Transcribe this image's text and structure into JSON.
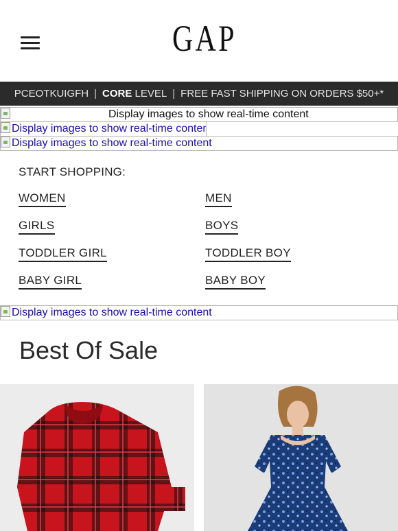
{
  "header": {
    "logo_text": "GAP",
    "menu_icon": "hamburger-menu-icon"
  },
  "promo_bar": {
    "member_id": "PCEOTKUIGFH",
    "separator": "|",
    "level_strong": "CORE",
    "level_rest": " LEVEL",
    "shipping": "FREE FAST SHIPPING ON ORDERS $50+*"
  },
  "image_placeholders": {
    "alt_text": "Display images to show real-time content"
  },
  "start_shopping": {
    "heading": "START SHOPPING:",
    "links": {
      "women": "WOMEN",
      "men": "MEN",
      "girls": "GIRLS",
      "boys": "BOYS",
      "toddler_girl": "TODDLER GIRL",
      "toddler_boy": "TODDLER BOY",
      "baby_girl": "BABY GIRL",
      "baby_boy": "BABY BOY"
    }
  },
  "best_of_sale": {
    "title": "Best Of Sale"
  },
  "colors": {
    "promo_bg": "#2b2b2b",
    "link_blue": "#1a0dab",
    "plaid_red": "#c8141c"
  }
}
